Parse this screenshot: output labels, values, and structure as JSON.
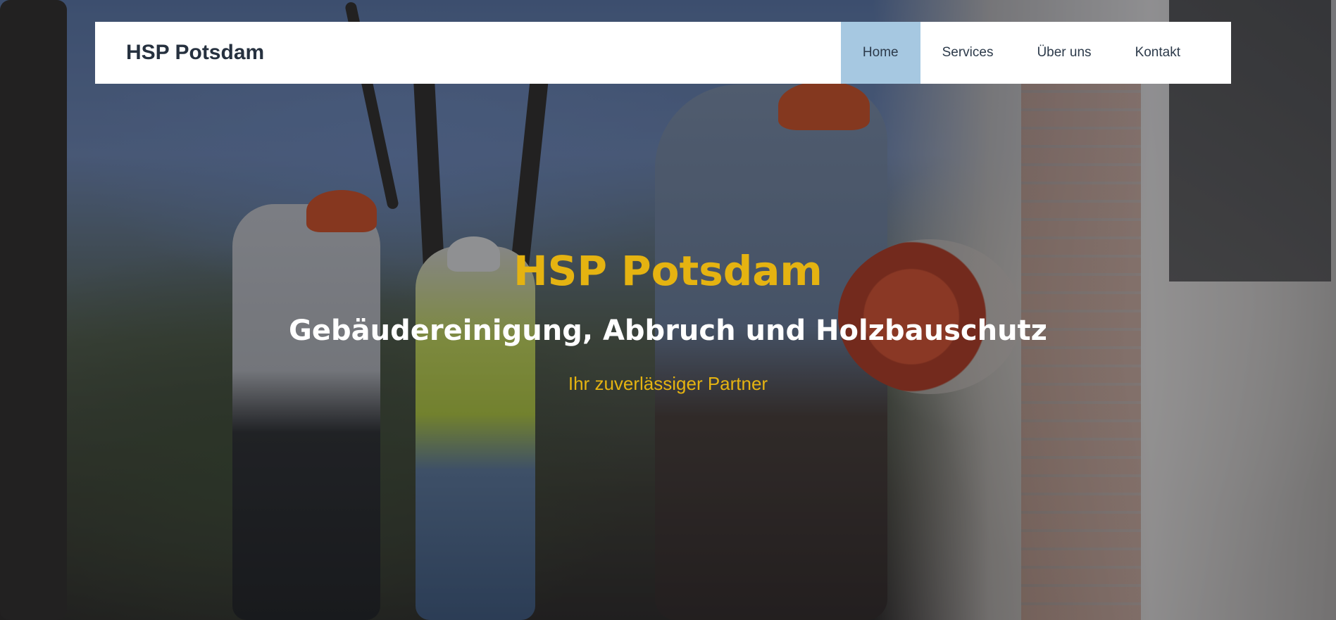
{
  "header": {
    "brand": "HSP Potsdam",
    "nav": [
      {
        "label": "Home",
        "active": true
      },
      {
        "label": "Services",
        "active": false
      },
      {
        "label": "Über uns",
        "active": false
      },
      {
        "label": "Kontakt",
        "active": false
      }
    ]
  },
  "hero": {
    "title": "HSP Potsdam",
    "subtitle": "Gebäudereinigung, Abbruch und Holzbauschutz",
    "tagline": "Ihr zuverlässiger Partner",
    "background_image": "demolition-workers-photo"
  },
  "colors": {
    "accent": "#e5b311",
    "nav_active": "#a6c8e1",
    "nav_text": "#2c3a4a",
    "brand_text": "#26313f"
  }
}
